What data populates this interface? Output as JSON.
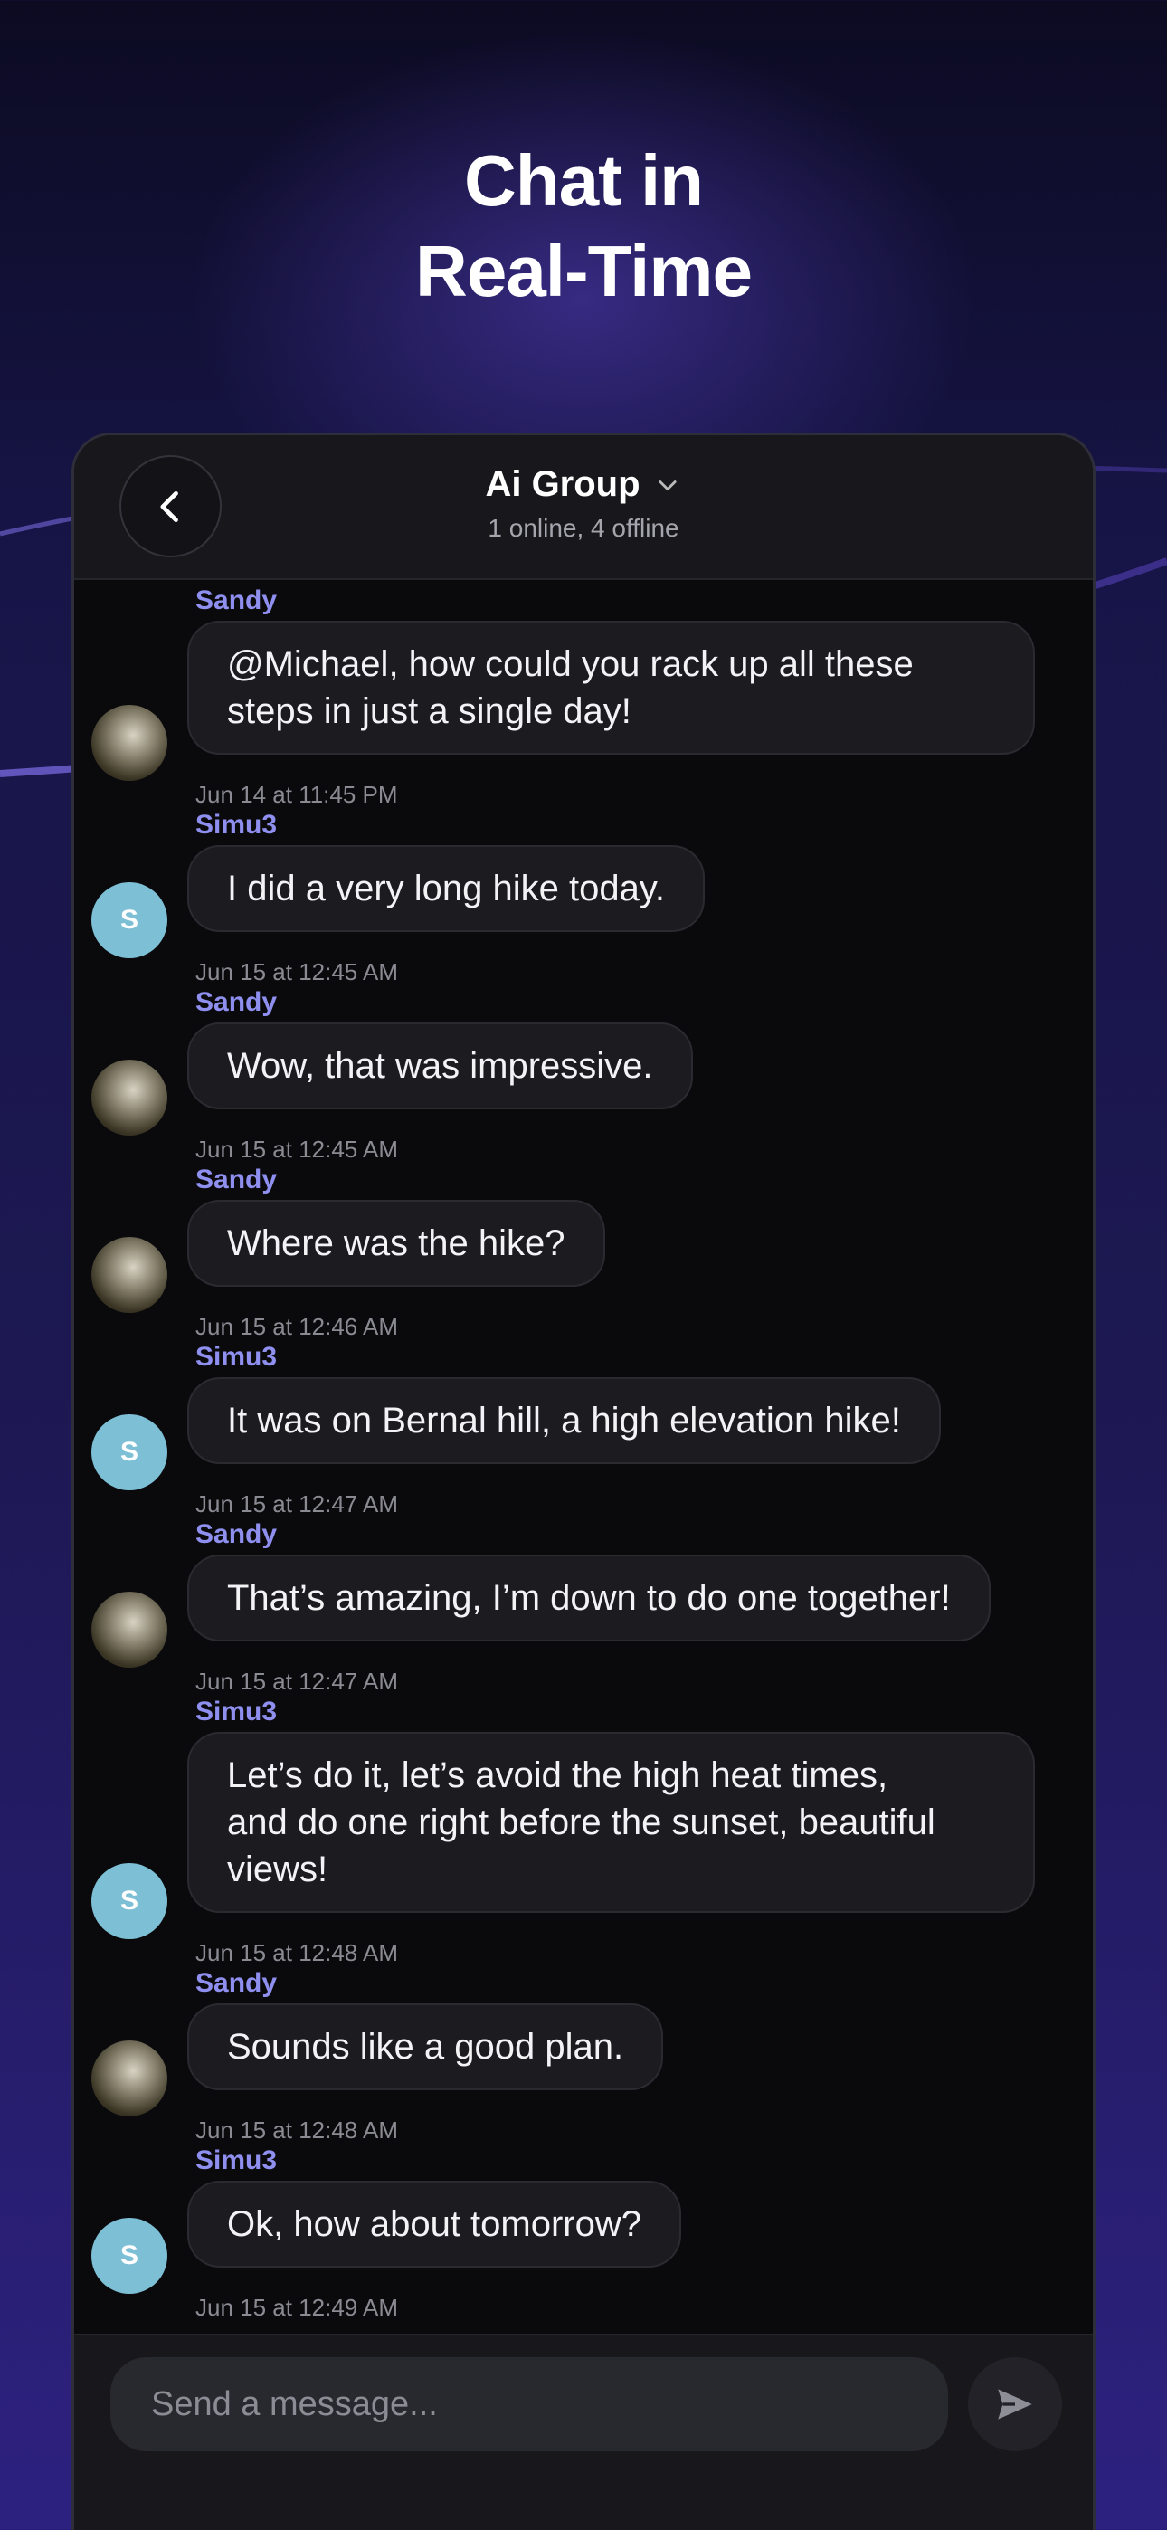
{
  "headline": {
    "line1": "Chat in",
    "line2": "Real-Time"
  },
  "header": {
    "title": "Ai Group",
    "subtitle": "1 online, 4 offline",
    "back_icon": "chevron-left-icon",
    "dropdown_icon": "chevron-down-icon"
  },
  "messages": [
    {
      "sender": "Sandy",
      "text_lines": [
        "@Michael, how could you rack up all these",
        "steps in just a single day!"
      ],
      "time": "Jun 14 at 11:45 PM",
      "avatar": "photo"
    },
    {
      "sender": "Simu3",
      "text_lines": [
        "I did a very long hike today."
      ],
      "time": "Jun 15 at 12:45 AM",
      "avatar": "S"
    },
    {
      "sender": "Sandy",
      "text_lines": [
        "Wow, that was impressive."
      ],
      "time": "Jun 15 at 12:45 AM",
      "avatar": "photo"
    },
    {
      "sender": "Sandy",
      "text_lines": [
        "Where was the hike?"
      ],
      "time": "Jun 15 at 12:46 AM",
      "avatar": "photo"
    },
    {
      "sender": "Simu3",
      "text_lines": [
        "It was on Bernal hill, a high elevation hike!"
      ],
      "time": "Jun 15 at 12:47 AM",
      "avatar": "S"
    },
    {
      "sender": "Sandy",
      "text_lines": [
        "That’s amazing, I’m down to do one together!"
      ],
      "time": "Jun 15 at 12:47 AM",
      "avatar": "photo"
    },
    {
      "sender": "Simu3",
      "text_lines": [
        "Let’s do it, let’s avoid the high heat times,",
        "and do one right before the sunset, beautiful",
        "views!"
      ],
      "time": "Jun 15 at 12:48 AM",
      "avatar": "S"
    },
    {
      "sender": "Sandy",
      "text_lines": [
        "Sounds like a good plan."
      ],
      "time": "Jun 15 at 12:48 AM",
      "avatar": "photo"
    },
    {
      "sender": "Simu3",
      "text_lines": [
        "Ok, how about tomorrow?"
      ],
      "time": "Jun 15 at 12:49 AM",
      "avatar": "S"
    }
  ],
  "composer": {
    "placeholder": "Send a message...",
    "send_icon": "send-icon"
  },
  "colors": {
    "accent_name": "#8f8ff0",
    "avatar_s": "#7dbfd5",
    "bubble": "#1b1b20"
  }
}
